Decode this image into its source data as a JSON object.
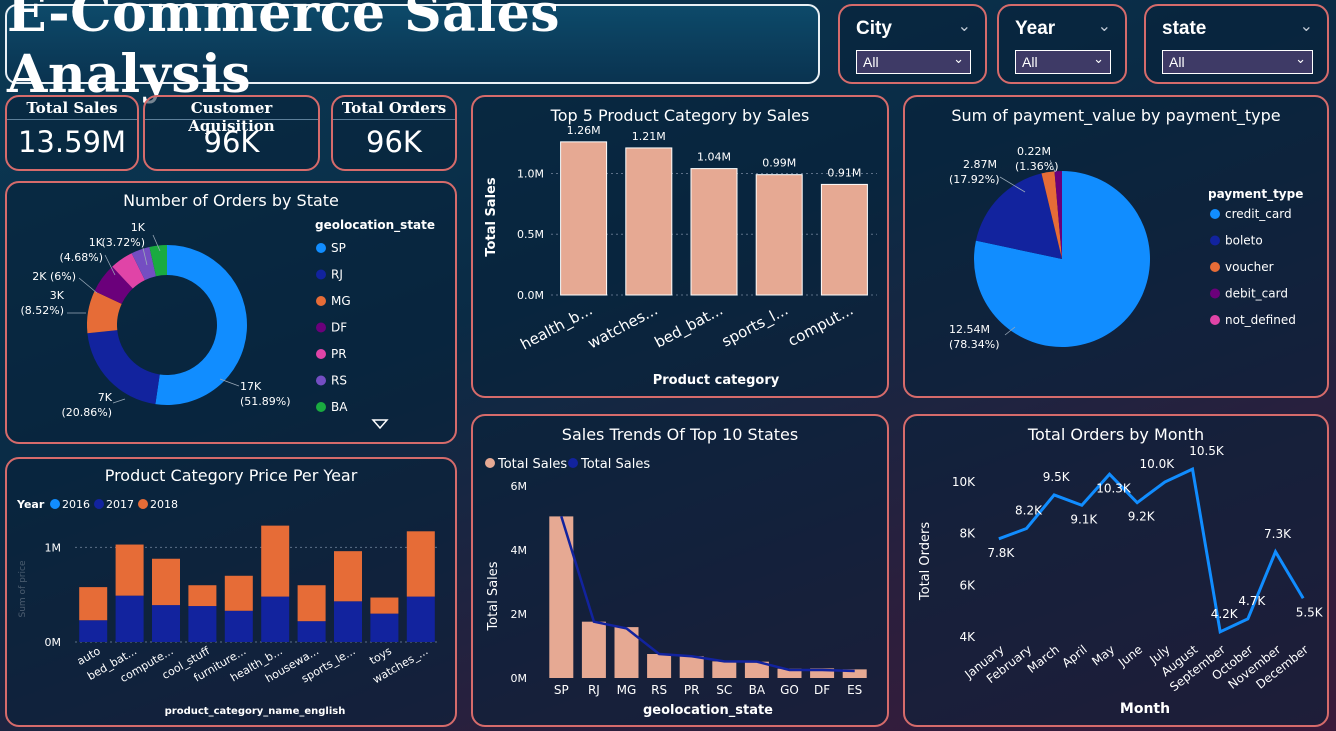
{
  "header": {
    "title": "E-Commerce Sales Analysis"
  },
  "slicers": [
    {
      "label": "City",
      "value": "All"
    },
    {
      "label": "Year",
      "value": "All"
    },
    {
      "label": "state",
      "value": "All"
    }
  ],
  "kpis": [
    {
      "label": "Total Sales",
      "value": "13.59M"
    },
    {
      "label": "Customer Aquisition",
      "value": "96K"
    },
    {
      "label": "Total Orders",
      "value": "96K"
    }
  ],
  "colors": {
    "panel_border": "#d66b6b",
    "peach": "#e6a993",
    "blue": "#118dff",
    "navy": "#12239e",
    "orange": "#e66c37",
    "purple": "#6b007b",
    "pink": "#e044a7",
    "darkpurple": "#744ec2",
    "green": "#1aab40"
  },
  "chart_data": [
    {
      "id": "orders-by-state",
      "type": "pie",
      "title": "Number of Orders by State",
      "legend_title": "geolocation_state",
      "legend_position": "right",
      "categories": [
        "SP",
        "RJ",
        "MG",
        "DF",
        "PR",
        "RS",
        "BA"
      ],
      "values": [
        51.89,
        20.86,
        8.52,
        6,
        4.68,
        3.72,
        3.5
      ],
      "labels": [
        "17K (51.89%)",
        "7K (20.86%)",
        "3K (8.52%)",
        "2K (6%)",
        "1K (4.68%)",
        "1K (3.72%)",
        "1K"
      ],
      "colors": [
        "#118dff",
        "#12239e",
        "#e66c37",
        "#6b007b",
        "#e044a7",
        "#744ec2",
        "#1aab40"
      ]
    },
    {
      "id": "top5-category",
      "type": "bar",
      "title": "Top 5 Product Category by Sales",
      "xlabel": "Product category",
      "ylabel": "Total Sales",
      "categories": [
        "health_b...",
        "watches...",
        "bed_bat...",
        "sports_l...",
        "comput..."
      ],
      "values": [
        1.26,
        1.21,
        1.04,
        0.99,
        0.91
      ],
      "value_labels": [
        "1.26M",
        "1.21M",
        "1.04M",
        "0.99M",
        "0.91M"
      ],
      "yticks": [
        "0.0M",
        "0.5M",
        "1.0M"
      ],
      "ylim": [
        0,
        1.3
      ]
    },
    {
      "id": "payment-type",
      "type": "pie",
      "title": "Sum of payment_value by payment_type",
      "legend_title": "payment_type",
      "legend_position": "right",
      "categories": [
        "credit_card",
        "boleto",
        "voucher",
        "debit_card",
        "not_defined"
      ],
      "values": [
        78.34,
        17.92,
        2.38,
        1.36,
        0.0
      ],
      "labels": [
        "12.54M (78.34%)",
        "2.87M (17.92%)",
        "",
        "0.22M (1.36%)",
        ""
      ],
      "colors": [
        "#118dff",
        "#12239e",
        "#e66c37",
        "#6b007b",
        "#e044a7"
      ]
    },
    {
      "id": "category-price-year",
      "type": "bar",
      "stacked": true,
      "title": "Product Category Price Per Year",
      "legend_title": "Year",
      "legend_position": "top-left",
      "xlabel": "product_category_name_english",
      "ylabel": "Sum of price",
      "categories": [
        "auto",
        "bed_bat...",
        "compute...",
        "cool_stuff",
        "furniture...",
        "health_b...",
        "housewa...",
        "sports_le...",
        "toys",
        "watches_..."
      ],
      "series": [
        {
          "name": "2016",
          "values": [
            0,
            0,
            0,
            0,
            0,
            0,
            0,
            0,
            0,
            0
          ]
        },
        {
          "name": "2017",
          "values": [
            0.23,
            0.49,
            0.39,
            0.38,
            0.33,
            0.48,
            0.22,
            0.43,
            0.3,
            0.48
          ]
        },
        {
          "name": "2018",
          "values": [
            0.35,
            0.54,
            0.49,
            0.22,
            0.37,
            0.75,
            0.38,
            0.53,
            0.17,
            0.69
          ]
        }
      ],
      "yticks": [
        "0M",
        "1M"
      ],
      "ylim": [
        0,
        1.3
      ]
    },
    {
      "id": "sales-trend-states",
      "type": "bar",
      "title": "Sales Trends Of Top 10 States",
      "legend": [
        "Total Sales",
        "Total Sales"
      ],
      "xlabel": "geolocation_state",
      "ylabel": "Total Sales",
      "categories": [
        "SP",
        "RJ",
        "MG",
        "RS",
        "PR",
        "SC",
        "BA",
        "GO",
        "DF",
        "ES"
      ],
      "values": [
        5.05,
        1.76,
        1.59,
        0.75,
        0.68,
        0.52,
        0.51,
        0.29,
        0.3,
        0.27
      ],
      "line_values": [
        5.05,
        1.76,
        1.55,
        0.75,
        0.68,
        0.52,
        0.51,
        0.25,
        0.25,
        0.22
      ],
      "yticks": [
        "0M",
        "2M",
        "4M",
        "6M"
      ],
      "ylim": [
        0,
        6
      ]
    },
    {
      "id": "orders-by-month",
      "type": "line",
      "title": "Total Orders by Month",
      "xlabel": "Month",
      "ylabel": "Total Orders",
      "categories": [
        "January",
        "February",
        "March",
        "April",
        "May",
        "June",
        "July",
        "August",
        "September",
        "October",
        "November",
        "December"
      ],
      "values": [
        7.8,
        8.2,
        9.5,
        9.1,
        10.3,
        9.2,
        10.0,
        10.5,
        4.2,
        4.7,
        7.3,
        5.5
      ],
      "value_labels": [
        "7.8K",
        "8.2K",
        "9.5K",
        "9.1K",
        "10.3K",
        "9.2K",
        "10.0K",
        "10.5K",
        "4.2K",
        "4.7K",
        "7.3K",
        "5.5K"
      ],
      "yticks": [
        "4K",
        "6K",
        "8K",
        "10K"
      ],
      "ylim": [
        4,
        11
      ]
    }
  ]
}
